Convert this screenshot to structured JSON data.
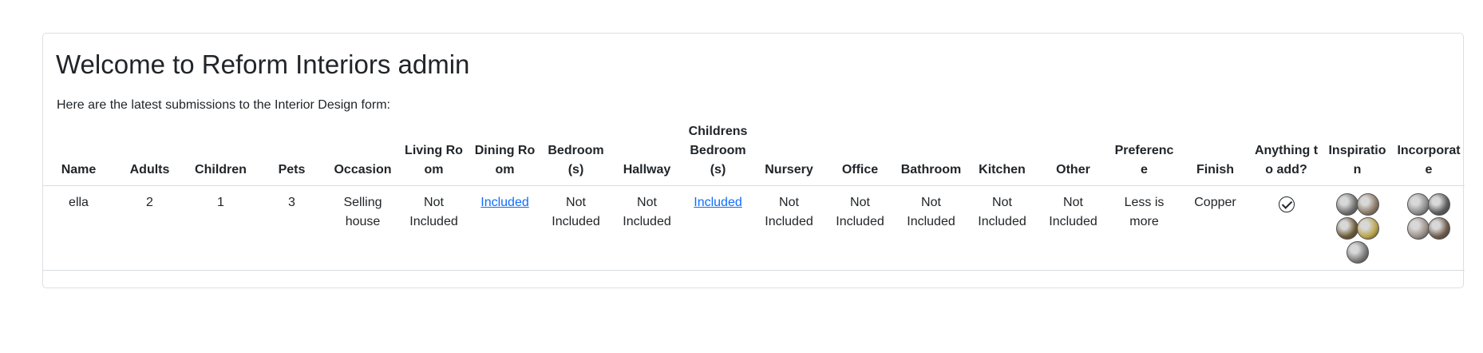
{
  "page": {
    "title": "Welcome to Reform Interiors admin",
    "intro": "Here are the latest submissions to the Interior Design form:"
  },
  "table": {
    "headers": [
      "Name",
      "Adults",
      "Children",
      "Pets",
      "Occasion",
      "Living Room",
      "Dining Room",
      "Bedroom (s)",
      "Hallway",
      "Childrens Bedroom (s)",
      "Nursery",
      "Office",
      "Bathroom",
      "Kitchen",
      "Other",
      "Preference",
      "Finish",
      "Anything to add?",
      "Inspiration",
      "Incorporate"
    ],
    "rows": [
      {
        "name": "ella",
        "adults": "2",
        "children": "1",
        "pets": "3",
        "occasion": "Selling house",
        "living_room": "Not Included",
        "dining_room": "Included",
        "bedrooms": "Not Included",
        "hallway": "Not Included",
        "childrens_bedrooms": "Included",
        "nursery": "Not Included",
        "office": "Not Included",
        "bathroom": "Not Included",
        "kitchen": "Not Included",
        "other": "Not Included",
        "preference": "Less is more",
        "finish": "Copper",
        "anything_to_add_icon": "check-circle-icon",
        "inspiration_images": [
          {
            "icon": "bw-interior-thumbnail",
            "color": "#6f6f6f"
          },
          {
            "icon": "room-thumbnail",
            "color": "#8a7a66"
          },
          {
            "icon": "wood-room-thumbnail",
            "color": "#6b5a36"
          },
          {
            "icon": "yellow-decor-thumbnail",
            "color": "#b9a34a"
          },
          {
            "icon": "bw-interior-thumbnail",
            "color": "#7a7a7a"
          }
        ],
        "incorporate_images": [
          {
            "icon": "bw-interior-thumbnail",
            "color": "#8c8c8c"
          },
          {
            "icon": "dark-interior-thumbnail",
            "color": "#5c5c5c"
          },
          {
            "icon": "bw-room-thumbnail",
            "color": "#9a8f88"
          },
          {
            "icon": "warm-room-thumbnail",
            "color": "#6e5a4a"
          }
        ]
      }
    ]
  },
  "colors": {
    "link": "#0d6efd",
    "text": "#212529",
    "border": "#dcdfe3"
  }
}
